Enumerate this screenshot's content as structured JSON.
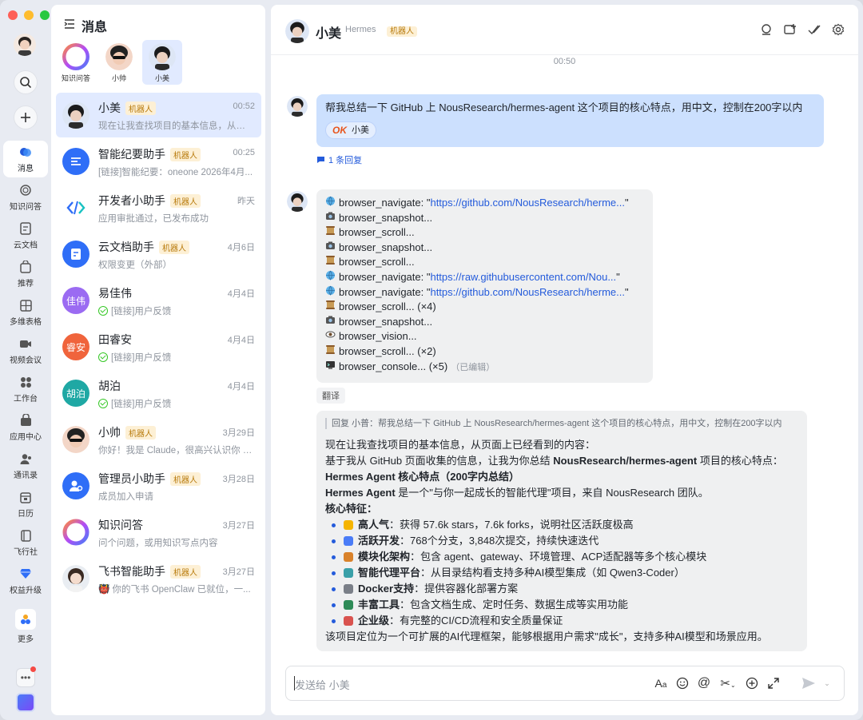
{
  "rail": {
    "items": [
      {
        "label": "消息"
      },
      {
        "label": "知识问答"
      },
      {
        "label": "云文档"
      },
      {
        "label": "推荐"
      },
      {
        "label": "多维表格"
      },
      {
        "label": "视频会议"
      },
      {
        "label": "工作台"
      },
      {
        "label": "应用中心"
      },
      {
        "label": "通讯录"
      },
      {
        "label": "日历"
      },
      {
        "label": "飞行社"
      },
      {
        "label": "权益升级"
      },
      {
        "label": "更多"
      }
    ]
  },
  "list": {
    "title": "消息",
    "pins": [
      {
        "label": "知识问答"
      },
      {
        "label": "小帅"
      },
      {
        "label": "小美"
      }
    ],
    "conversations": [
      {
        "name": "小美",
        "tag": "机器人",
        "time": "00:52",
        "preview": "现在让我查找项目的基本信息，从页面上已经看到的内容："
      },
      {
        "name": "智能纪要助手",
        "tag": "机器人",
        "time": "00:25",
        "preview": "[链接]智能纪要：oneone 2026年4月..."
      },
      {
        "name": "开发者小助手",
        "tag": "机器人",
        "time": "昨天",
        "preview": "应用审批通过，已发布成功"
      },
      {
        "name": "云文档助手",
        "tag": "机器人",
        "time": "4月6日",
        "preview": "权限变更（外部）"
      },
      {
        "name": "易佳伟",
        "tag": "",
        "time": "4月4日",
        "preview": "[链接]用户反馈",
        "initials": "佳伟"
      },
      {
        "name": "田睿安",
        "tag": "",
        "time": "4月4日",
        "preview": "[链接]用户反馈",
        "initials": "睿安"
      },
      {
        "name": "胡泊",
        "tag": "",
        "time": "4月4日",
        "preview": "[链接]用户反馈",
        "initials": "胡泊"
      },
      {
        "name": "小帅",
        "tag": "机器人",
        "time": "3月29日",
        "preview": "你好！我是 Claude，很高兴认识你 👋"
      },
      {
        "name": "管理员小助手",
        "tag": "机器人",
        "time": "3月28日",
        "preview": "成员加入申请"
      },
      {
        "name": "知识问答",
        "tag": "",
        "time": "3月27日",
        "preview": "问个问题，或用知识写点内容"
      },
      {
        "name": "飞书智能助手",
        "tag": "机器人",
        "time": "3月27日",
        "preview": "👹 你的飞书 OpenClaw 已就位，一..."
      }
    ]
  },
  "chat": {
    "name": "小美",
    "subtitle": "Hermes",
    "tag": "机器人",
    "time_divider": "00:50",
    "msg1": {
      "text": "帮我总结一下 GitHub 上 NousResearch/hermes-agent 这个项目的核心特点，用中文，控制在200字以内",
      "reaction_icon": "OK",
      "reaction_user": "小美"
    },
    "reply_count": "1 条回复",
    "tool_lines": [
      {
        "icon": "globe",
        "prefix": "browser_navigate: \"",
        "link": "https://github.com/NousResearch/herme...",
        "suffix": "\""
      },
      {
        "icon": "camera",
        "prefix": "browser_snapshot...",
        "link": "",
        "suffix": ""
      },
      {
        "icon": "scroll",
        "prefix": "browser_scroll...",
        "link": "",
        "suffix": ""
      },
      {
        "icon": "camera",
        "prefix": "browser_snapshot...",
        "link": "",
        "suffix": ""
      },
      {
        "icon": "scroll",
        "prefix": "browser_scroll...",
        "link": "",
        "suffix": ""
      },
      {
        "icon": "globe",
        "prefix": "browser_navigate: \"",
        "link": "https://raw.githubusercontent.com/Nou...",
        "suffix": "\""
      },
      {
        "icon": "globe",
        "prefix": "browser_navigate: \"",
        "link": "https://github.com/NousResearch/herme...",
        "suffix": "\""
      },
      {
        "icon": "scroll",
        "prefix": "browser_scroll... (×4)",
        "link": "",
        "suffix": ""
      },
      {
        "icon": "camera",
        "prefix": "browser_snapshot...",
        "link": "",
        "suffix": ""
      },
      {
        "icon": "eye",
        "prefix": "browser_vision...",
        "link": "",
        "suffix": ""
      },
      {
        "icon": "scroll",
        "prefix": "browser_scroll... (×2)",
        "link": "",
        "suffix": ""
      },
      {
        "icon": "console",
        "prefix": "browser_console... (×5)",
        "link": "",
        "suffix": ""
      }
    ],
    "edited_label": "（已编辑）",
    "translate_label": "翻译",
    "reply": {
      "quote": "回复 小普：帮我总结一下 GitHub 上 NousResearch/hermes-agent 这个项目的核心特点，用中文，控制在200字以内",
      "line1": "现在让我查找项目的基本信息，从页面上已经看到的内容：",
      "line2_pre": "基于我从 GitHub 页面收集的信息，让我为你总结 ",
      "line2_bold": "NousResearch/hermes-agent",
      "line2_post": " 项目的核心特点：",
      "heading": "Hermes Agent 核心特点（200字内总结）",
      "line3_bold": "Hermes Agent",
      "line3_post": " 是一个\"与你一起成长的智能代理\"项目，来自 NousResearch 团队。",
      "features_heading": "核心特征：",
      "bullets": [
        {
          "emoji": "⭐",
          "color": "#f5b400",
          "bold": "高人气",
          "text": "：获得 57.6k stars，7.6k forks，说明社区活跃度极高"
        },
        {
          "emoji": "🔄",
          "color": "#4a7cf7",
          "bold": "活跃开发",
          "text": "：768个分支，3,848次提交，持续快速迭代"
        },
        {
          "emoji": "🏗",
          "color": "#d9822b",
          "bold": "模块化架构",
          "text": "：包含 agent、gateway、环境管理、ACP适配器等多个核心模块"
        },
        {
          "emoji": "🤖",
          "color": "#3aa0a8",
          "bold": "智能代理平台",
          "text": "：从目录结构看支持多种AI模型集成（如 Qwen3-Coder）"
        },
        {
          "emoji": "⚙",
          "color": "#7a7f88",
          "bold": "Docker支持",
          "text": "：提供容器化部署方案"
        },
        {
          "emoji": "📚",
          "color": "#2e8b57",
          "bold": "丰富工具",
          "text": "：包含文档生成、定时任务、数据生成等实用功能"
        },
        {
          "emoji": "🛡",
          "color": "#d9534f",
          "bold": "企业级",
          "text": "：有完整的CI/CD流程和安全质量保证"
        }
      ],
      "closing": "该项目定位为一个可扩展的AI代理框架，能够根据用户需求\"成长\"，支持多种AI模型和场景应用。"
    },
    "composer_placeholder": "发送给 小美"
  },
  "colors": {
    "accent": "#245bdb",
    "active_bg": "#e1eaff",
    "bubble_self": "#cce0fe",
    "bubble_other": "#eff0f1",
    "tag_bg": "#fdf0d5",
    "tag_text": "#b87a0b"
  }
}
